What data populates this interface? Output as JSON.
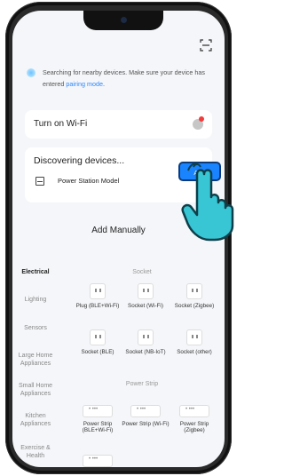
{
  "scan_label": "scan-icon",
  "search": {
    "text": "Searching for nearby devices. Make sure your device has entered",
    "link": "pairing mode",
    "end": "."
  },
  "wifi": {
    "title": "Turn on Wi-Fi"
  },
  "discover": {
    "title": "Discovering devices...",
    "device": "Power Station Model",
    "add_label": "Add"
  },
  "add_manually": "Add Manually",
  "categories": [
    "Electrical",
    "Lighting",
    "Sensors",
    "Large Home Appliances",
    "Small Home Appliances",
    "Kitchen Appliances",
    "Exercise & Health"
  ],
  "sections": {
    "socket": "Socket",
    "power_strip": "Power Strip"
  },
  "tiles": [
    "Plug (BLE+Wi-Fi)",
    "Socket (Wi-Fi)",
    "Socket (Zigbee)",
    "Socket (BLE)",
    "Socket (NB-IoT)",
    "Socket (other)",
    "Power Strip (BLE+Wi-Fi)",
    "Power Strip (Wi-Fi)",
    "Power Strip (Zigbee)"
  ],
  "colors": {
    "accent": "#1a84ff",
    "badge": "#f23c3c"
  }
}
